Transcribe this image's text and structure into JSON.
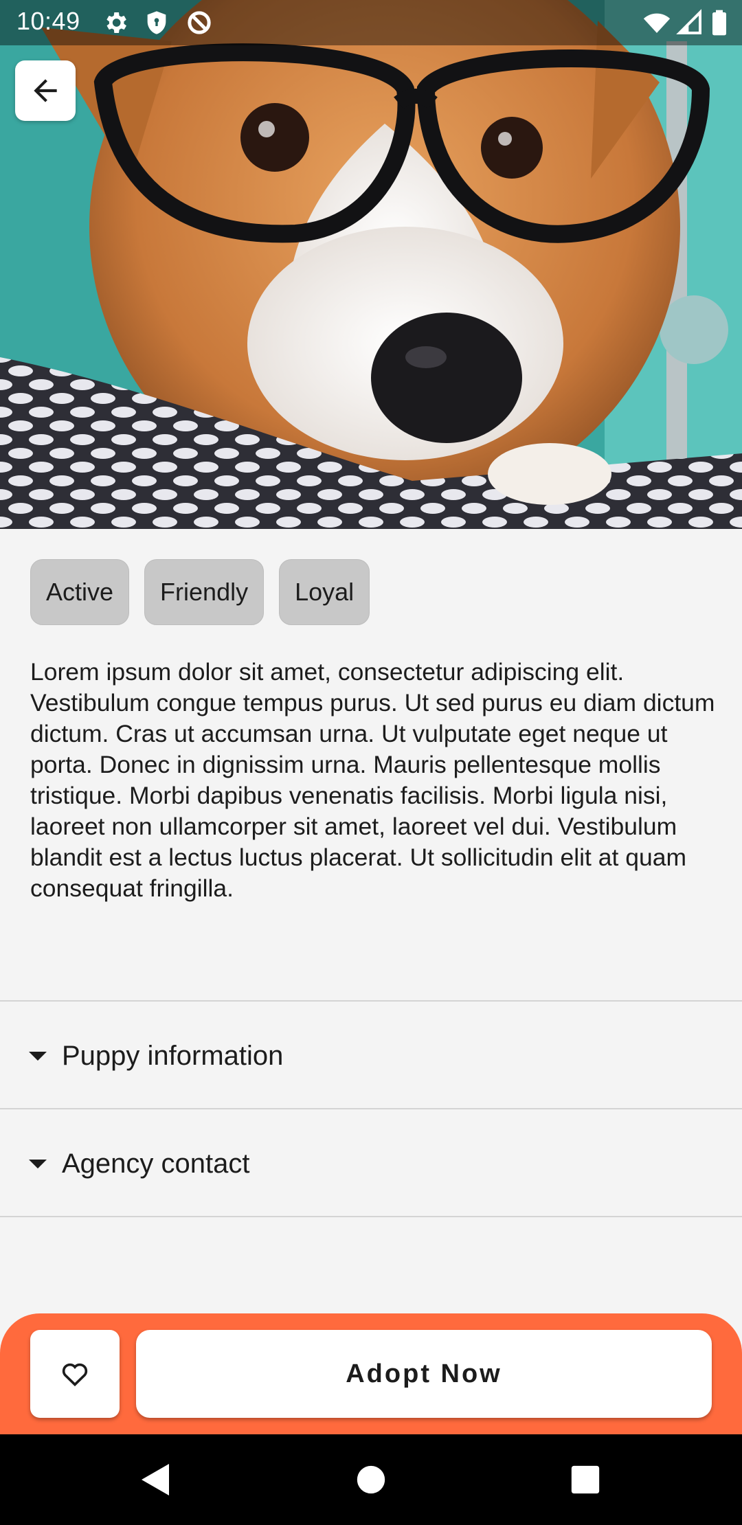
{
  "status_bar": {
    "time": "10:49",
    "left_icons": [
      "gear-icon",
      "shield-icon",
      "data-saver-icon"
    ],
    "right_icons": [
      "wifi-icon",
      "signal-icon",
      "battery-icon"
    ]
  },
  "hero": {
    "image_icon": "dog-photo",
    "back_icon": "arrow-back-icon"
  },
  "chips": [
    "Active",
    "Friendly",
    "Loyal"
  ],
  "description": "Lorem ipsum dolor sit amet, consectetur adipiscing elit. Vestibulum congue tempus purus. Ut sed purus eu diam dictum dictum. Cras ut accumsan urna. Ut vulputate eget neque ut porta. Donec in dignissim urna. Mauris pellentesque mollis tristique. Morbi dapibus venenatis facilisis. Morbi ligula nisi, laoreet non ullamcorper sit amet, laoreet vel dui. Vestibulum blandit est a lectus luctus placerat. Ut sollicitudin elit at quam consequat fringilla.",
  "sections": [
    {
      "label": "Puppy information",
      "icon": "caret-down-icon"
    },
    {
      "label": "Agency contact",
      "icon": "caret-down-icon"
    }
  ],
  "actions": {
    "favorite_icon": "heart-outline-icon",
    "adopt_label": "Adopt Now",
    "bar_color": "#ff6a3d"
  },
  "nav_bar": {
    "icons": [
      "nav-back-icon",
      "nav-home-icon",
      "nav-recents-icon"
    ]
  }
}
